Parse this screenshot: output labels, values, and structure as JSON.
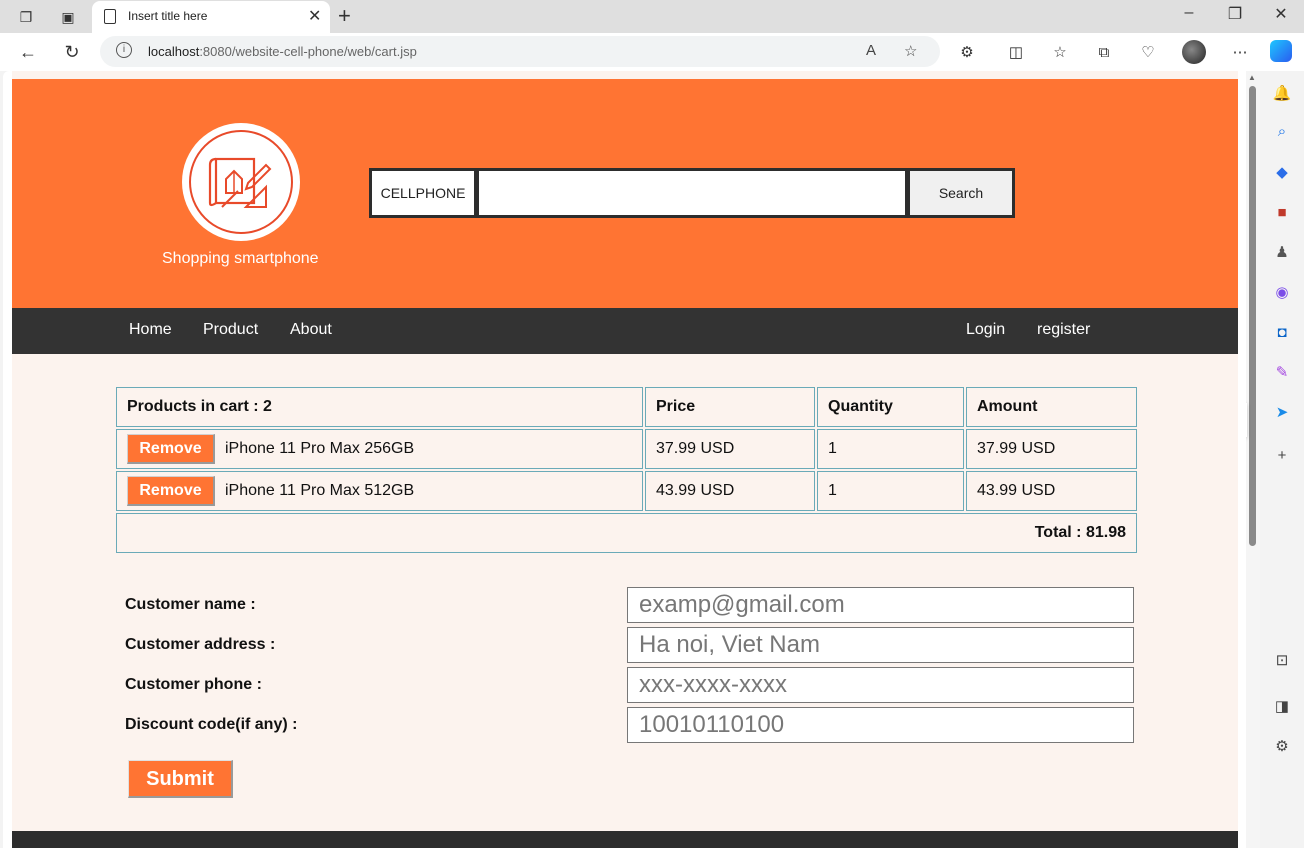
{
  "browser": {
    "tab_title": "Insert title here",
    "url_host": "localhost",
    "url_rest": ":8080/website-cell-phone/web/cart.jsp"
  },
  "header": {
    "brand": "Shopping smartphone",
    "search_category": "CELLPHONE",
    "search_value": "",
    "search_button": "Search",
    "accent_color": "#ff7433"
  },
  "menu": {
    "left": [
      "Home",
      "Product",
      "About"
    ],
    "right": [
      "Login",
      "register"
    ]
  },
  "cart": {
    "headers": {
      "products": "Products in cart : 2",
      "price": "Price",
      "quantity": "Quantity",
      "amount": "Amount"
    },
    "remove_label": "Remove",
    "rows": [
      {
        "name": "iPhone 11 Pro Max 256GB",
        "price": "37.99 USD",
        "quantity": "1",
        "amount": "37.99 USD"
      },
      {
        "name": "iPhone 11 Pro Max 512GB",
        "price": "43.99 USD",
        "quantity": "1",
        "amount": "43.99 USD"
      }
    ],
    "total": "Total : 81.98"
  },
  "form": {
    "name_label": "Customer name :",
    "name_placeholder": "examp@gmail.com",
    "address_label": "Customer address :",
    "address_placeholder": "Ha noi, Viet Nam",
    "phone_label": "Customer phone :",
    "phone_placeholder": "xxx-xxxx-xxxx",
    "discount_label": "Discount code(if any) :",
    "discount_placeholder": "10010110100",
    "submit_label": "Submit"
  }
}
